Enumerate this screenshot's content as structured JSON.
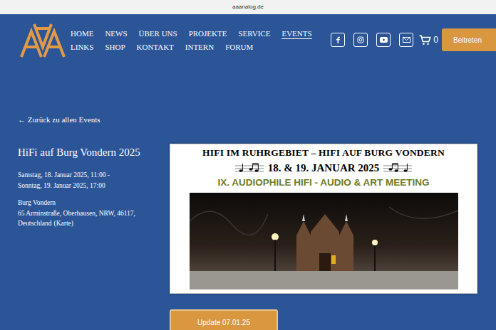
{
  "browser": {
    "address": "aaanalog.de"
  },
  "nav": [
    [
      {
        "label": "HOME",
        "selected": false
      },
      {
        "label": "NEWS",
        "selected": false
      },
      {
        "label": "ÜBER UNS",
        "selected": false
      },
      {
        "label": "PROJEKTE",
        "selected": false
      },
      {
        "label": "SERVICE",
        "selected": false
      },
      {
        "label": "EVENTS",
        "selected": true
      }
    ],
    [
      {
        "label": "LINKS",
        "selected": false
      },
      {
        "label": "SHOP",
        "selected": false
      },
      {
        "label": "KONTAKT",
        "selected": false
      },
      {
        "label": "INTERN",
        "selected": false
      },
      {
        "label": "FORUM",
        "selected": false
      }
    ]
  ],
  "cart": {
    "count": "0"
  },
  "join_button": "Beitreten",
  "back_link": "← Zurück zu allen Events",
  "event": {
    "title": "HiFi auf Burg Vondern 2025",
    "dates": [
      "Samstag, 18. Januar 2025, 11:00 -",
      "Sonntag, 19. Januar 2025, 17:00"
    ],
    "location": {
      "name": "Burg Vondern",
      "street": "65 Arminstraße, Oberhausen, NRW, 46117,",
      "country": "Deutschland",
      "map_link": "(Karte)"
    }
  },
  "poster": {
    "headline": "HIFI IM RUHRGEBIET – HIFI AUF BURG VONDERN",
    "date": "18. & 19. JANUAR 2025",
    "subtitle": "IX. AUDIOPHILE HIFI - AUDIO & ART MEETING"
  },
  "update_button": "Update 07.01.25"
}
